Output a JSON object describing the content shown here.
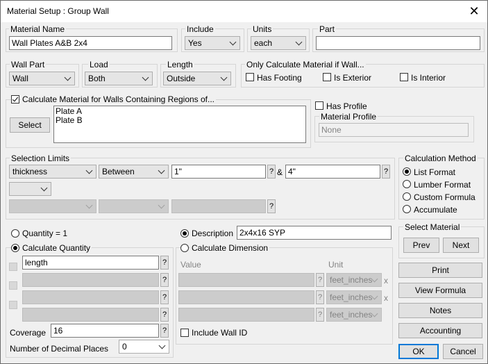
{
  "window": {
    "title": "Material Setup :   Group  Wall"
  },
  "top": {
    "material_name_label": "Material Name",
    "material_name_value": "Wall Plates A&B 2x4",
    "include_label": "Include",
    "include_value": "Yes",
    "units_label": "Units",
    "units_value": "each",
    "part_label": "Part",
    "part_value": ""
  },
  "row2": {
    "wall_part_label": "Wall Part",
    "wall_part_value": "Wall",
    "load_label": "Load",
    "load_value": "Both",
    "length_label": "Length",
    "length_value": "Outside",
    "only_calc_label": "Only Calculate Material if Wall...",
    "has_footing": "Has Footing",
    "is_exterior": "Is Exterior",
    "is_interior": "Is Interior"
  },
  "regions": {
    "calc_regions_label": "Calculate Material for Walls Containing Regions of...",
    "select_button": "Select",
    "items": [
      "Plate A",
      "Plate B"
    ],
    "has_profile": "Has Profile",
    "material_profile_label": "Material Profile",
    "material_profile_value": "None"
  },
  "selection_limits": {
    "label": "Selection Limits",
    "field_value": "thickness",
    "op_value": "Between",
    "min_value": "1\"",
    "and_label": "&",
    "max_value": "4\""
  },
  "calc_method": {
    "label": "Calculation Method",
    "options": [
      "List Format",
      "Lumber Format",
      "Custom Formula",
      "Accumulate"
    ]
  },
  "quantity": {
    "quantity_eq_1": "Quantity = 1",
    "calc_quantity": "Calculate Quantity",
    "formula1": "length",
    "coverage_label": "Coverage",
    "coverage_value": "16",
    "decimals_label": "Number of Decimal Places",
    "decimals_value": "0"
  },
  "description": {
    "description_label": "Description",
    "description_value": "2x4x16 SYP",
    "calc_dimension": "Calculate Dimension",
    "value_header": "Value",
    "unit_header": "Unit",
    "unit_value": "feet_inches",
    "x_label": "x",
    "include_wall_id": "Include Wall ID"
  },
  "select_material": {
    "label": "Select Material",
    "prev": "Prev",
    "next": "Next"
  },
  "buttons": {
    "print": "Print",
    "view_formula": "View Formula",
    "notes": "Notes",
    "accounting": "Accounting",
    "ok": "OK",
    "cancel": "Cancel"
  },
  "help_glyph": "?"
}
